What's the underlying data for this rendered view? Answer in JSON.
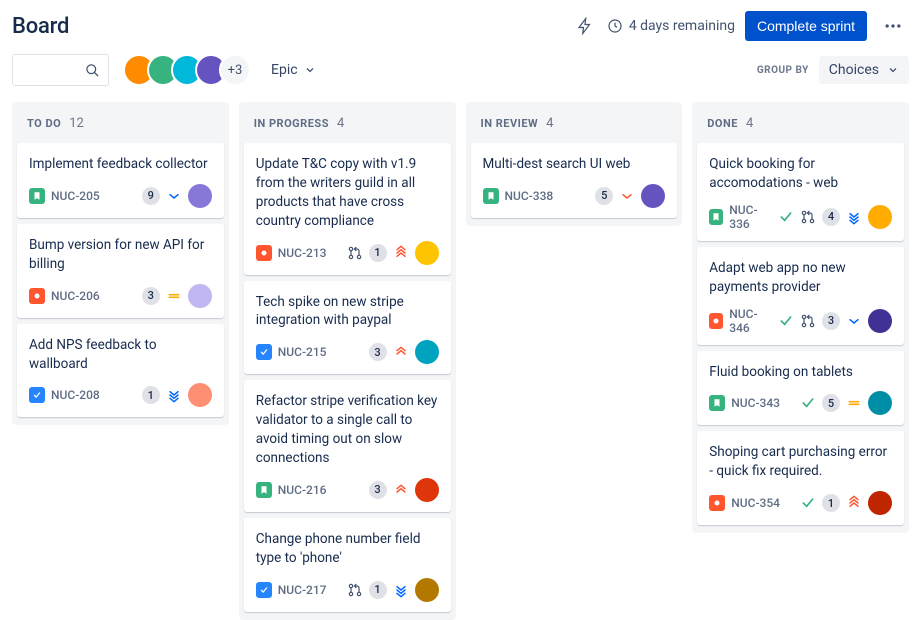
{
  "header": {
    "title": "Board",
    "time_remaining": "4 days remaining",
    "complete_label": "Complete sprint"
  },
  "toolbar": {
    "avatars_more": "+3",
    "epic_label": "Epic",
    "groupby_label": "GROUP BY",
    "groupby_value": "Choices"
  },
  "avatar_colors": [
    "#FF8B00",
    "#36B37E",
    "#00B8D9",
    "#6554C0"
  ],
  "columns": [
    {
      "title": "TO DO",
      "count": 12,
      "cards": [
        {
          "title": "Implement feedback collector",
          "type": "story",
          "key": "NUC-205",
          "points": 9,
          "priority": "low",
          "assignee_color": "#8777D9",
          "show_tick": false,
          "show_pr": false
        },
        {
          "title": "Bump version for new API for billing",
          "type": "bug",
          "key": "NUC-206",
          "points": 3,
          "priority": "medium",
          "assignee_color": "#C0B6F2",
          "show_tick": false,
          "show_pr": false
        },
        {
          "title": "Add NPS feedback to wallboard",
          "type": "task",
          "key": "NUC-208",
          "points": 1,
          "priority": "lowest",
          "assignee_color": "#FF8F73",
          "show_tick": false,
          "show_pr": false
        }
      ]
    },
    {
      "title": "IN PROGRESS",
      "count": 4,
      "cards": [
        {
          "title": "Update T&C copy with v1.9 from the writers guild in all products that have cross country compliance",
          "type": "bug",
          "key": "NUC-213",
          "points": 1,
          "priority": "highest",
          "assignee_color": "#FFC400",
          "show_tick": false,
          "show_pr": true
        },
        {
          "title": "Tech spike on new stripe integration with paypal",
          "type": "task",
          "key": "NUC-215",
          "points": 3,
          "priority": "high",
          "assignee_color": "#00A3BF",
          "show_tick": false,
          "show_pr": false
        },
        {
          "title": "Refactor stripe verification key validator to a single call to avoid timing out on slow connections",
          "type": "story",
          "key": "NUC-216",
          "points": 3,
          "priority": "high",
          "assignee_color": "#DE350B",
          "show_tick": false,
          "show_pr": false
        },
        {
          "title": "Change phone number field type to 'phone'",
          "type": "task",
          "key": "NUC-217",
          "points": 1,
          "priority": "lowest",
          "assignee_color": "#B37800",
          "show_tick": false,
          "show_pr": true
        }
      ]
    },
    {
      "title": "IN REVIEW",
      "count": 4,
      "cards": [
        {
          "title": "Multi-dest search UI web",
          "type": "story",
          "key": "NUC-338",
          "points": 5,
          "priority": "low-red",
          "assignee_color": "#6554C0",
          "show_tick": false,
          "show_pr": false
        }
      ]
    },
    {
      "title": "DONE",
      "count": 4,
      "cards": [
        {
          "title": "Quick booking for accomodations - web",
          "type": "story",
          "key": "NUC-336",
          "points": 4,
          "priority": "lowest",
          "assignee_color": "#FFAB00",
          "show_tick": true,
          "show_pr": true
        },
        {
          "title": "Adapt web app no new payments provider",
          "type": "bug",
          "key": "NUC-346",
          "points": 3,
          "priority": "low",
          "assignee_color": "#403294",
          "show_tick": true,
          "show_pr": true
        },
        {
          "title": "Fluid booking on tablets",
          "type": "story",
          "key": "NUC-343",
          "points": 5,
          "priority": "medium",
          "assignee_color": "#008DA6",
          "show_tick": true,
          "show_pr": false
        },
        {
          "title": "Shoping cart purchasing error - quick fix required.",
          "type": "bug",
          "key": "NUC-354",
          "points": 1,
          "priority": "highest",
          "assignee_color": "#BF2600",
          "show_tick": true,
          "show_pr": false
        }
      ]
    }
  ]
}
